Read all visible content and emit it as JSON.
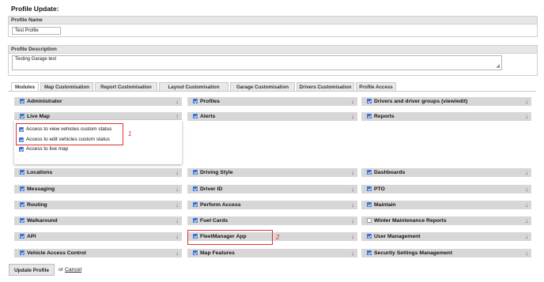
{
  "page_title": "Profile Update:",
  "profile_name": {
    "label": "Profile Name",
    "value": "Test Profile"
  },
  "profile_description": {
    "label": "Profile Description",
    "value": "Testing Garage test"
  },
  "tabs": [
    {
      "label": "Modules",
      "active": true
    },
    {
      "label": "Map Customisation"
    },
    {
      "label": "Report Customisation"
    },
    {
      "label": "Layout Customisation"
    },
    {
      "label": "Garage Customisation"
    },
    {
      "label": "Drivers Customisation"
    },
    {
      "label": "Profile Access"
    }
  ],
  "modules": {
    "col1": [
      {
        "label": "Administrator",
        "checked": true,
        "arrow": "↓"
      },
      {
        "label": "Live Map",
        "checked": true,
        "arrow": "↑"
      },
      {
        "label": "Locations",
        "checked": true,
        "arrow": "↓"
      },
      {
        "label": "Messaging",
        "checked": true,
        "arrow": "↓"
      },
      {
        "label": "Routing",
        "checked": true,
        "arrow": "↓"
      },
      {
        "label": "Walkaround",
        "checked": true,
        "arrow": "↓"
      },
      {
        "label": "API",
        "checked": true,
        "arrow": "↓"
      },
      {
        "label": "Vehicle Access Control",
        "checked": true,
        "arrow": "↓"
      }
    ],
    "col2": [
      {
        "label": "Profiles",
        "checked": true,
        "arrow": "↓"
      },
      {
        "label": "Alerts",
        "checked": true,
        "arrow": "↓"
      },
      {
        "label": "Driving Style",
        "checked": true,
        "arrow": "↓"
      },
      {
        "label": "Driver ID",
        "checked": true,
        "arrow": "↓"
      },
      {
        "label": "Perform Access",
        "checked": true,
        "arrow": "↓"
      },
      {
        "label": "Fuel Cards",
        "checked": true,
        "arrow": "↓"
      },
      {
        "label": "FleetManager App",
        "checked": true,
        "arrow": "↓"
      },
      {
        "label": "Map Features",
        "checked": true,
        "arrow": "↓"
      }
    ],
    "col3": [
      {
        "label": "Drivers and driver groups (view/edit)",
        "checked": true,
        "arrow": "↓"
      },
      {
        "label": "Reports",
        "checked": true,
        "arrow": "↓"
      },
      {
        "label": "Dashboards",
        "checked": true,
        "arrow": "↓"
      },
      {
        "label": "PTO",
        "checked": true,
        "arrow": "↓"
      },
      {
        "label": "Maintain",
        "checked": true,
        "arrow": "↓"
      },
      {
        "label": "Winter Maintenance Reports",
        "checked": false,
        "arrow": "↓"
      },
      {
        "label": "User Management",
        "checked": true,
        "arrow": "↓"
      },
      {
        "label": "Security Settings Management",
        "checked": true,
        "arrow": "↓"
      }
    ]
  },
  "live_map_options": [
    {
      "label": "Access to view vehicles custom status",
      "checked": true
    },
    {
      "label": "Access to edit vehicles custom status",
      "checked": true
    },
    {
      "label": "Access to live map",
      "checked": true
    }
  ],
  "annotations": {
    "one": "1",
    "two": "2"
  },
  "actions": {
    "update_label": "Update Profile",
    "or_text": "or",
    "cancel_label": "Cancel"
  },
  "colors": {
    "checkbox": "#3b73d1",
    "highlight": "#e0312e",
    "module_bar": "#d7d7d7"
  }
}
